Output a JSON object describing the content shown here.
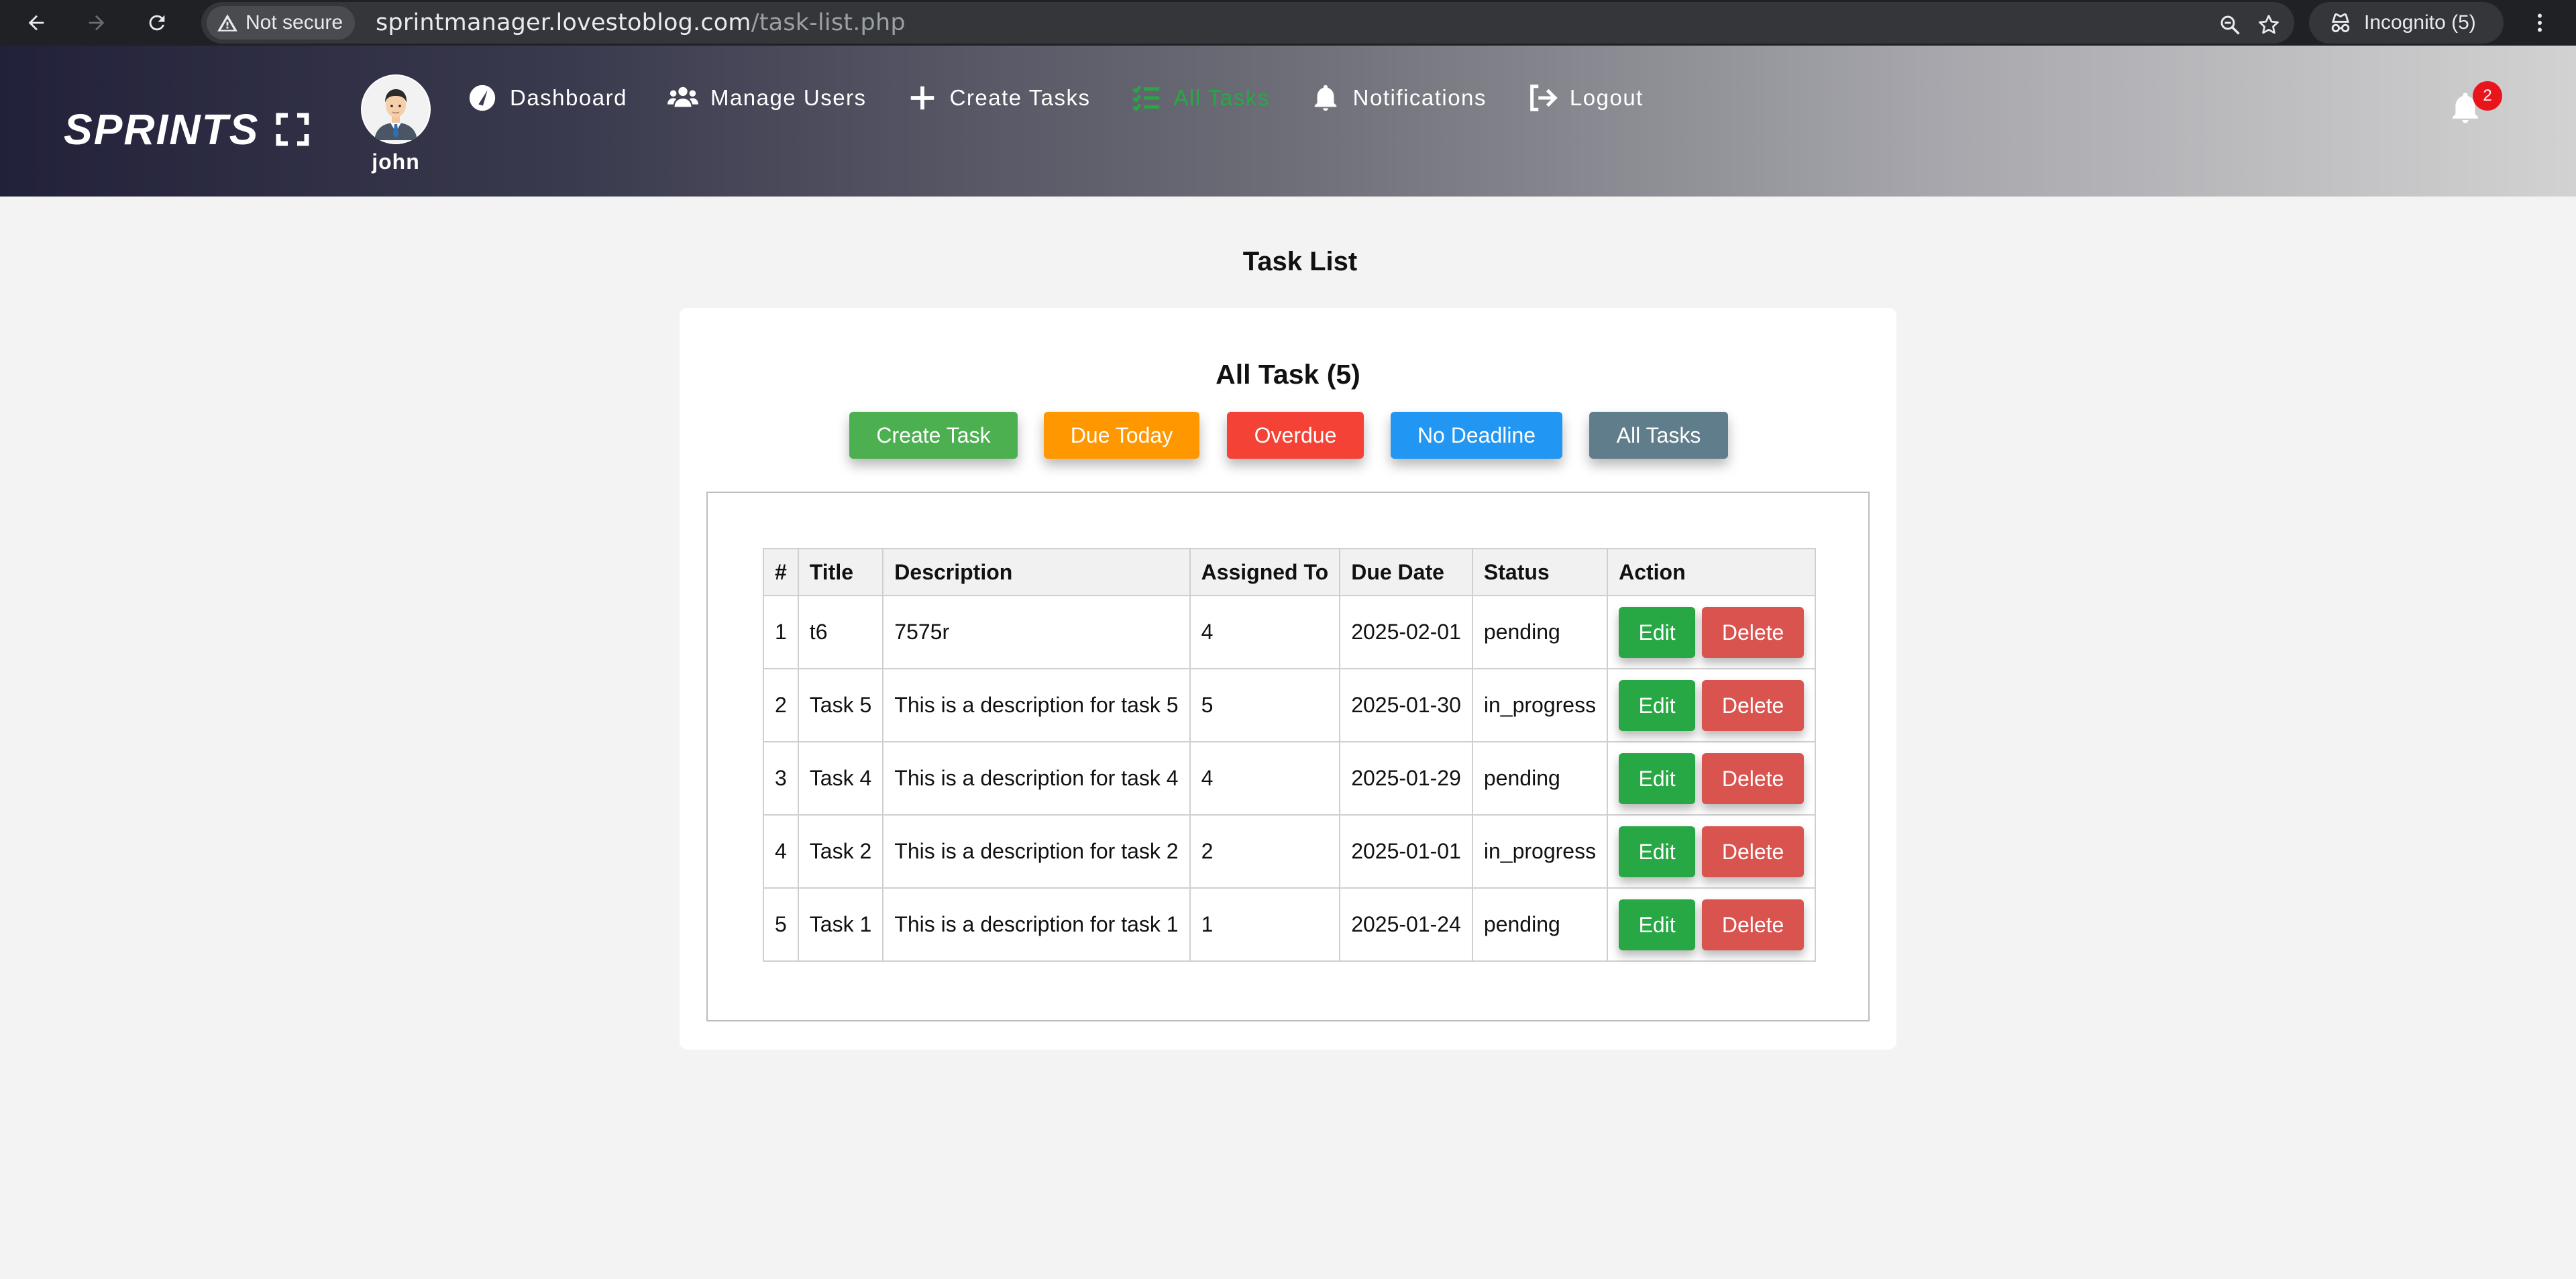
{
  "browser": {
    "security_label": "Not secure",
    "url_host": "sprintmanager.lovestoblog.com",
    "url_path": "/task-list.php",
    "incognito_label": "Incognito (5)"
  },
  "header": {
    "logo_text": "SPRINTS",
    "username": "john",
    "menu": [
      {
        "label": "Dashboard",
        "icon": "gauge-icon"
      },
      {
        "label": "Manage Users",
        "icon": "users-icon"
      },
      {
        "label": "Create Tasks",
        "icon": "plus-icon"
      },
      {
        "label": "All Tasks",
        "icon": "tasks-list-icon",
        "active": true
      },
      {
        "label": "Notifications",
        "icon": "bell-icon"
      },
      {
        "label": "Logout",
        "icon": "logout-icon"
      }
    ],
    "notification_count": "2"
  },
  "page": {
    "title": "Task List",
    "card_title": "All Task (5)"
  },
  "filters": [
    {
      "label": "Create Task",
      "color": "#4caf50"
    },
    {
      "label": "Due Today",
      "color": "#ff9800"
    },
    {
      "label": "Overdue",
      "color": "#f44336"
    },
    {
      "label": "No Deadline",
      "color": "#2196f3"
    },
    {
      "label": "All Tasks",
      "color": "#607d8b"
    }
  ],
  "table": {
    "headers": [
      "#",
      "Title",
      "Description",
      "Assigned To",
      "Due Date",
      "Status",
      "Action"
    ],
    "rows": [
      {
        "num": "1",
        "title": "t6",
        "description": "7575r",
        "assigned": "4",
        "due": "2025-02-01",
        "status": "pending"
      },
      {
        "num": "2",
        "title": "Task 5",
        "description": "This is a description for task 5",
        "assigned": "5",
        "due": "2025-01-30",
        "status": "in_progress"
      },
      {
        "num": "3",
        "title": "Task 4",
        "description": "This is a description for task 4",
        "assigned": "4",
        "due": "2025-01-29",
        "status": "pending"
      },
      {
        "num": "4",
        "title": "Task 2",
        "description": "This is a description for task 2",
        "assigned": "2",
        "due": "2025-01-01",
        "status": "in_progress"
      },
      {
        "num": "5",
        "title": "Task 1",
        "description": "This is a description for task 1",
        "assigned": "1",
        "due": "2025-01-24",
        "status": "pending"
      }
    ],
    "edit_label": "Edit",
    "delete_label": "Delete"
  }
}
